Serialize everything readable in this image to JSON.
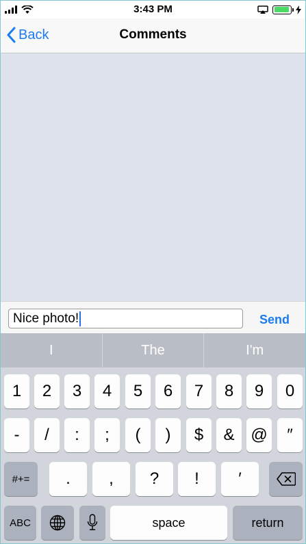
{
  "status_bar": {
    "time": "3:43 PM",
    "battery_color": "#4cd964"
  },
  "nav": {
    "back_label": "Back",
    "title": "Comments"
  },
  "composer": {
    "input_value": "Nice photo!",
    "send_label": "Send"
  },
  "keyboard": {
    "suggestions": [
      "I",
      "The",
      "I'm"
    ],
    "row1": [
      "1",
      "2",
      "3",
      "4",
      "5",
      "6",
      "7",
      "8",
      "9",
      "0"
    ],
    "row2": [
      "-",
      "/",
      ":",
      ";",
      "(",
      ")",
      "$",
      "&",
      "@",
      "″"
    ],
    "row3": [
      ".",
      ",",
      "?",
      "!",
      "′"
    ],
    "symbols_label": "#+=",
    "abc_label": "ABC",
    "space_label": "space",
    "return_label": "return"
  },
  "icons": {
    "back": "chevron-left-icon",
    "delete": "backspace-icon",
    "globe": "globe-icon",
    "mic": "microphone-icon"
  }
}
